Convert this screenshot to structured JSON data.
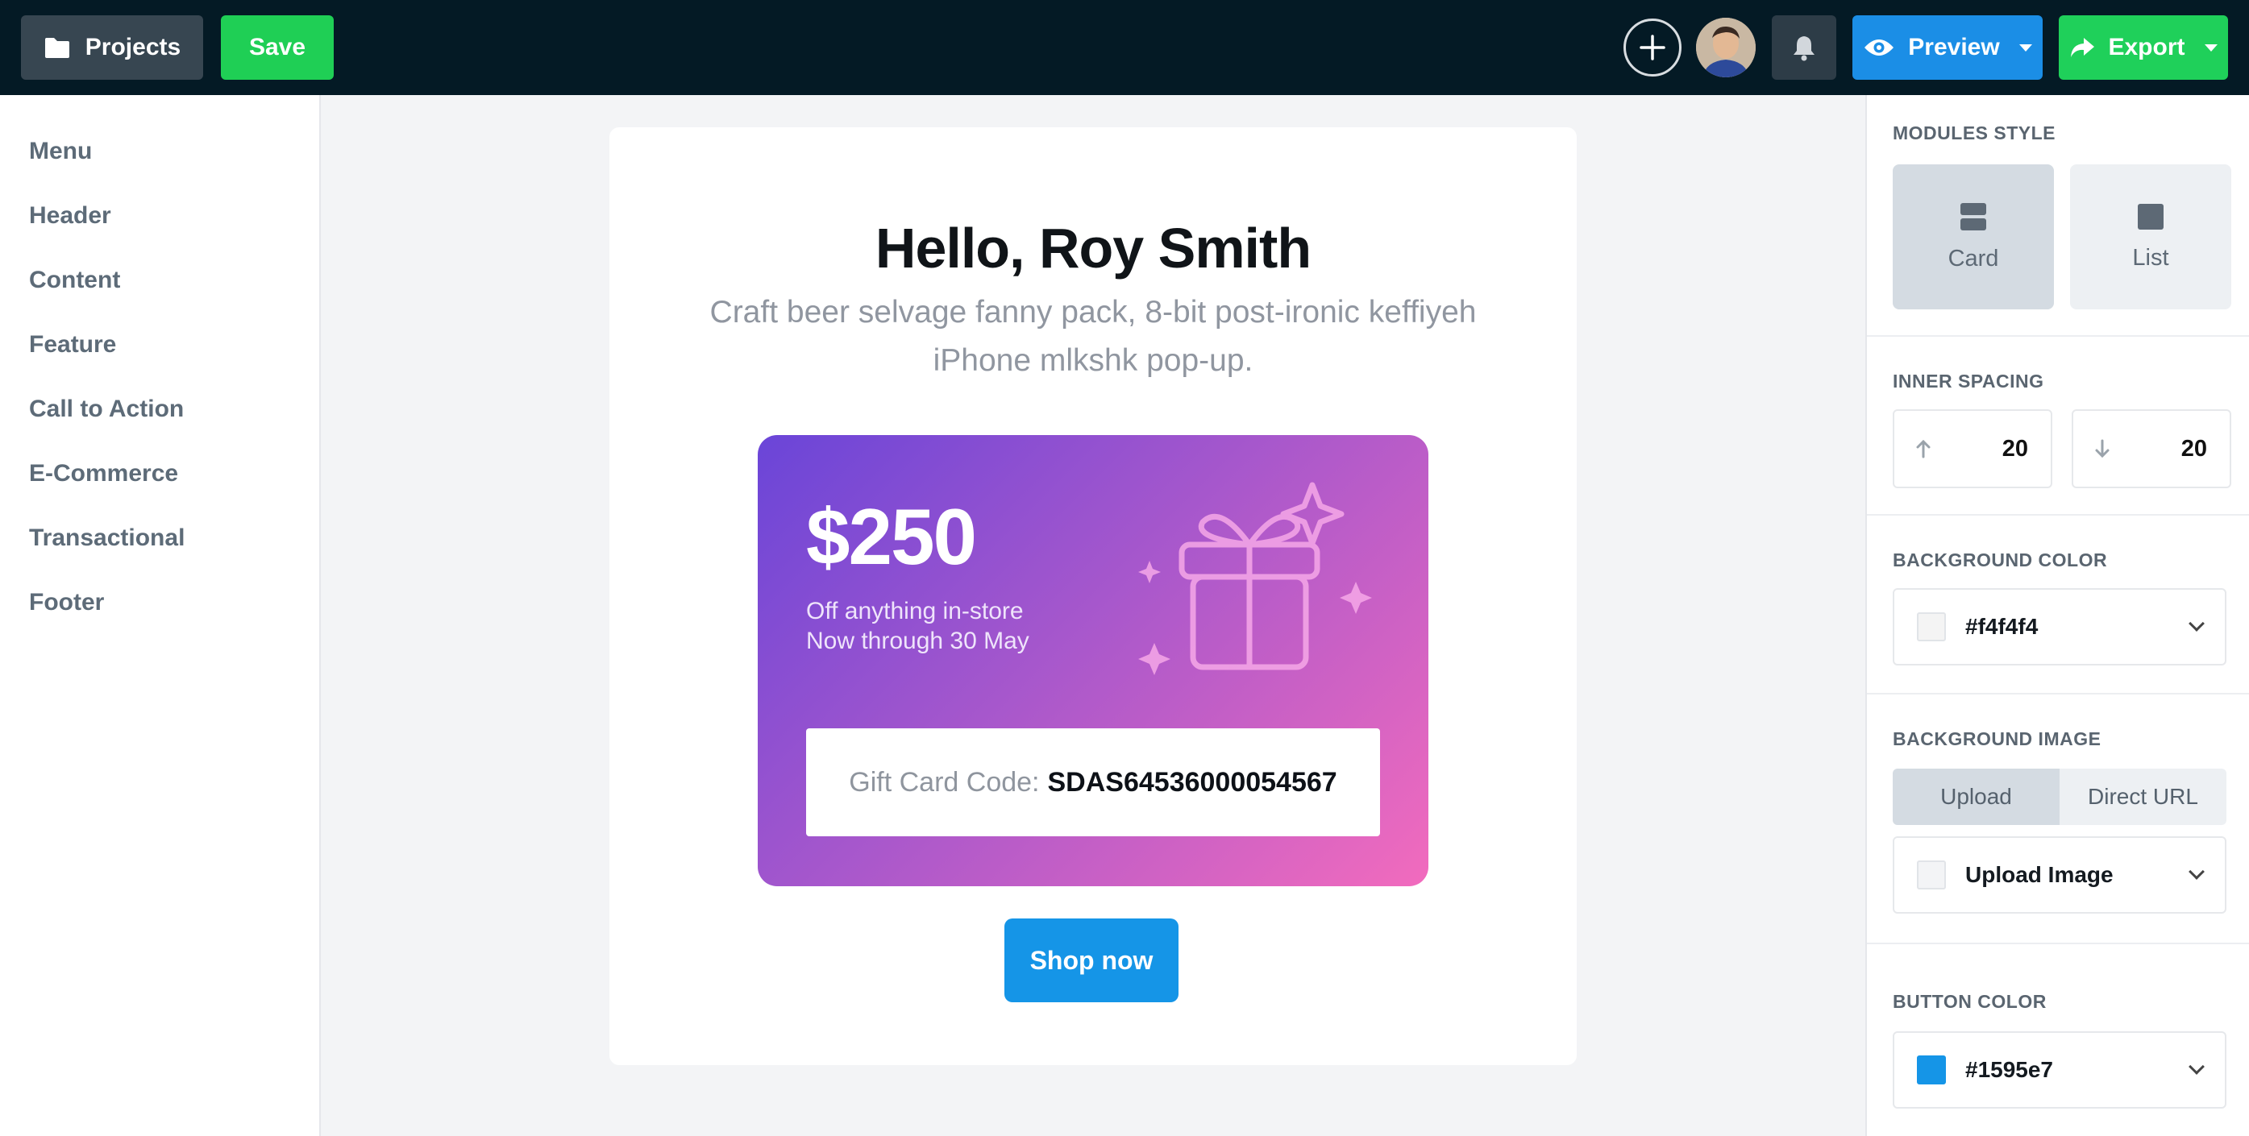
{
  "toolbar": {
    "projects_label": "Projects",
    "save_label": "Save",
    "preview_label": "Preview",
    "export_label": "Export"
  },
  "sidebar": {
    "items": [
      {
        "label": "Menu"
      },
      {
        "label": "Header"
      },
      {
        "label": "Content"
      },
      {
        "label": "Feature"
      },
      {
        "label": "Call to Action"
      },
      {
        "label": "E-Commerce"
      },
      {
        "label": "Transactional"
      },
      {
        "label": "Footer"
      }
    ]
  },
  "email": {
    "greeting": "Hello, Roy Smith",
    "lead": "Craft beer selvage fanny pack, 8-bit post-ironic keffiyeh iPhone mlkshk pop-up.",
    "amount": "$250",
    "offer_line1": "Off anything in-store",
    "offer_line2": "Now through 30 May",
    "code_label": "Gift Card Code:",
    "code_value": "SDAS64536000054567",
    "cta_label": "Shop now"
  },
  "panel": {
    "modules_style": {
      "title": "MODULES STYLE",
      "options": [
        "Card",
        "List"
      ],
      "selected": "Card"
    },
    "inner_spacing": {
      "title": "INNER SPACING",
      "top": "20",
      "bottom": "20"
    },
    "background_color": {
      "title": "BACKGROUND COLOR",
      "value": "#f4f4f4"
    },
    "background_image": {
      "title": "BACKGROUND IMAGE",
      "tabs": [
        "Upload",
        "Direct URL"
      ],
      "selected_tab": "Upload",
      "select_label": "Upload Image"
    },
    "button_color": {
      "title": "BUTTON COLOR",
      "value": "#1595e7"
    }
  },
  "colors": {
    "topbar": "#041a25",
    "save": "#1fcf55",
    "preview": "#1b8ee6",
    "export": "#1fd05a",
    "button": "#1595e7"
  }
}
